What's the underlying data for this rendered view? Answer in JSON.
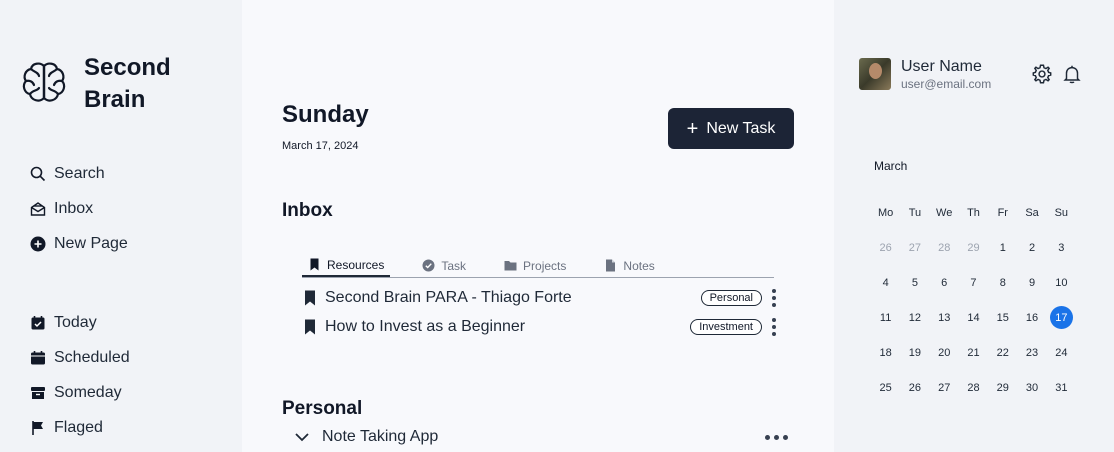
{
  "brand": {
    "name": "Second Brain"
  },
  "sidebar": {
    "top_items": [
      {
        "label": "Search",
        "icon": "search-icon"
      },
      {
        "label": "Inbox",
        "icon": "inbox-icon"
      },
      {
        "label": "New Page",
        "icon": "plus-circle-icon"
      }
    ],
    "bottom_items": [
      {
        "label": "Today",
        "icon": "calendar-check-icon"
      },
      {
        "label": "Scheduled",
        "icon": "calendar-icon"
      },
      {
        "label": "Someday",
        "icon": "archive-icon"
      },
      {
        "label": "Flaged",
        "icon": "flag-icon"
      }
    ]
  },
  "main": {
    "day": "Sunday",
    "date": "March 17, 2024",
    "new_task_label": "New Task",
    "inbox": {
      "title": "Inbox",
      "tabs": [
        {
          "label": "Resources",
          "icon": "bookmark-icon",
          "active": true
        },
        {
          "label": "Task",
          "icon": "check-circle-icon",
          "active": false
        },
        {
          "label": "Projects",
          "icon": "folder-icon",
          "active": false
        },
        {
          "label": "Notes",
          "icon": "file-icon",
          "active": false
        }
      ],
      "items": [
        {
          "title": "Second Brain PARA - Thiago Forte",
          "tag": "Personal"
        },
        {
          "title": "How to Invest as a Beginner",
          "tag": "Investment"
        }
      ]
    },
    "personal": {
      "title": "Personal",
      "project": "Note Taking App"
    }
  },
  "user": {
    "name": "User Name",
    "email": "user@email.com"
  },
  "calendar": {
    "month": "March",
    "weekdays": [
      "Mo",
      "Tu",
      "We",
      "Th",
      "Fr",
      "Sa",
      "Su"
    ],
    "weeks": [
      [
        "26",
        "27",
        "28",
        "29",
        "1",
        "2",
        "3"
      ],
      [
        "4",
        "5",
        "6",
        "7",
        "8",
        "9",
        "10"
      ],
      [
        "11",
        "12",
        "13",
        "14",
        "15",
        "16",
        "17"
      ],
      [
        "18",
        "19",
        "20",
        "21",
        "22",
        "23",
        "24"
      ],
      [
        "25",
        "26",
        "27",
        "28",
        "29",
        "30",
        "31"
      ]
    ],
    "muted_first_week_count": 4,
    "selected": "17",
    "selected_color": "#1a73e8"
  },
  "colors": {
    "button_bg": "#1c2436",
    "main_bg": "#f8f9fc",
    "panel_bg": "#f1f3f7"
  }
}
